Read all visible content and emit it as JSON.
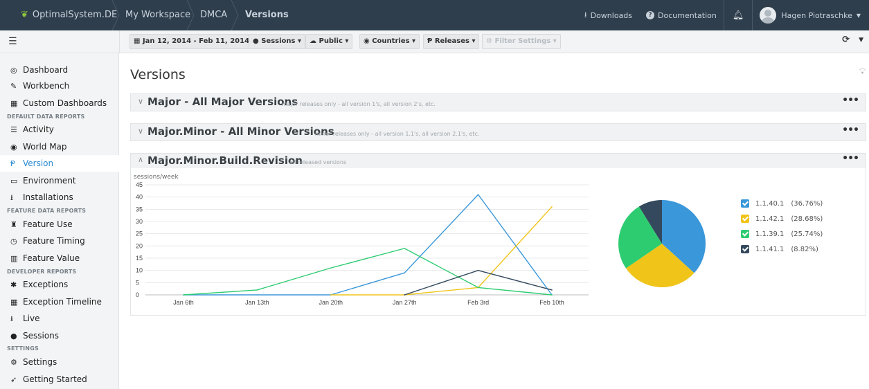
{
  "topbar": {
    "brand": "OptimalSystem.DE",
    "breadcrumbs": [
      "My Workspace",
      "DMCA",
      "Versions"
    ],
    "downloads": "Downloads",
    "documentation": "Documentation",
    "user": "Hagen Piotraschke"
  },
  "filters": {
    "date_range": "Jan 12, 2014 - Feb 11, 2014",
    "sessions": "Sessions",
    "public": "Public",
    "countries": "Countries",
    "releases": "Releases",
    "filter_settings": "Filter Settings"
  },
  "sidebar": {
    "items_top": [
      {
        "label": "Dashboard",
        "icon": "dashboard-icon"
      },
      {
        "label": "Workbench",
        "icon": "edit-icon"
      },
      {
        "label": "Custom Dashboards",
        "icon": "grid-icon"
      }
    ],
    "section_default": "DEFAULT DATA REPORTS",
    "items_default": [
      {
        "label": "Activity",
        "icon": "activity-icon"
      },
      {
        "label": "World Map",
        "icon": "globe-icon"
      },
      {
        "label": "Version",
        "icon": "version-icon"
      },
      {
        "label": "Environment",
        "icon": "monitor-icon"
      },
      {
        "label": "Installations",
        "icon": "download-icon"
      }
    ],
    "section_feature": "FEATURE DATA REPORTS",
    "items_feature": [
      {
        "label": "Feature Use",
        "icon": "feature-icon"
      },
      {
        "label": "Feature Timing",
        "icon": "clock-icon"
      },
      {
        "label": "Feature Value",
        "icon": "bar-chart-icon"
      }
    ],
    "section_developer": "DEVELOPER REPORTS",
    "items_developer": [
      {
        "label": "Exceptions",
        "icon": "bug-icon"
      },
      {
        "label": "Exception Timeline",
        "icon": "calendar-icon"
      },
      {
        "label": "Live",
        "icon": "live-icon"
      },
      {
        "label": "Sessions",
        "icon": "user-icon"
      }
    ],
    "section_settings": "SETTINGS",
    "items_settings": [
      {
        "label": "Settings",
        "icon": "gear-icon"
      },
      {
        "label": "Getting Started",
        "icon": "rocket-icon"
      }
    ],
    "active": "Version"
  },
  "main": {
    "title": "Versions",
    "panels": [
      {
        "title": "Major - All Major Versions",
        "subtitle": "major releases only - all version 1's, all version 2's, etc.",
        "expanded": false
      },
      {
        "title": "Major.Minor - All Minor Versions",
        "subtitle": "minor releases only - all version 1.1's, all version 2.1's, etc.",
        "expanded": false
      },
      {
        "title": "Major.Minor.Build.Revision",
        "subtitle": "all released versions",
        "expanded": true
      }
    ]
  },
  "colors": {
    "blue": "#3a97d9",
    "yellow": "#f0c419",
    "green": "#2ecc71",
    "navy": "#34495e"
  },
  "chart_data": [
    {
      "type": "line",
      "ylabel": "sessions/week",
      "ylim": [
        0,
        45
      ],
      "yticks": [
        0,
        5,
        10,
        15,
        20,
        25,
        30,
        35,
        40,
        45
      ],
      "categories": [
        "Jan 6th",
        "Jan 13th",
        "Jan 20th",
        "Jan 27th",
        "Feb 3rd",
        "Feb 10th"
      ],
      "series": [
        {
          "name": "1.1.40.1",
          "color": "#3a97d9",
          "values": [
            0,
            0,
            0,
            9,
            41,
            0
          ]
        },
        {
          "name": "1.1.42.1",
          "color": "#f0c419",
          "values": [
            null,
            null,
            0,
            0,
            3,
            36
          ]
        },
        {
          "name": "1.1.39.1",
          "color": "#2ecc71",
          "values": [
            0,
            2,
            11,
            19,
            3,
            0
          ]
        },
        {
          "name": "1.1.41.1",
          "color": "#34495e",
          "values": [
            null,
            null,
            null,
            0,
            10,
            2
          ]
        }
      ],
      "grid": true
    },
    {
      "type": "pie",
      "slices": [
        {
          "name": "1.1.40.1",
          "pct": 36.76,
          "color": "#3a97d9",
          "label": "(36.76%)"
        },
        {
          "name": "1.1.42.1",
          "pct": 28.68,
          "color": "#f0c419",
          "label": "(28.68%)"
        },
        {
          "name": "1.1.39.1",
          "pct": 25.74,
          "color": "#2ecc71",
          "label": "(25.74%)"
        },
        {
          "name": "1.1.41.1",
          "pct": 8.82,
          "color": "#34495e",
          "label": "(8.82%)"
        }
      ],
      "legend": "right"
    }
  ]
}
